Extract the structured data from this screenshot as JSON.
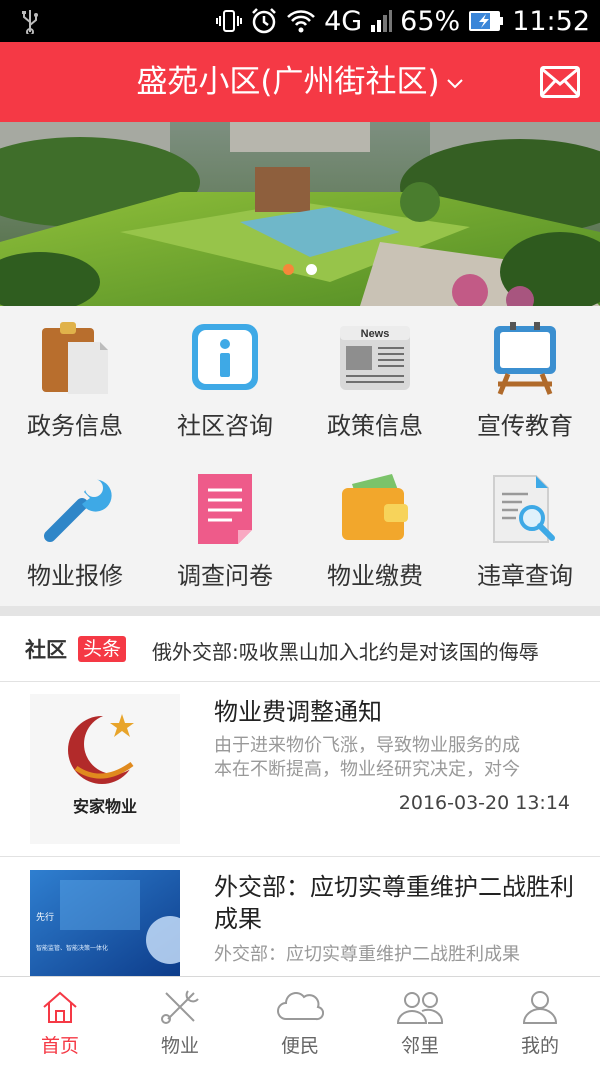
{
  "status_bar": {
    "network": "4G",
    "battery": "65%",
    "time": "11:52"
  },
  "header": {
    "community": "盛苑小区(广州街社区)",
    "icons": [
      "chevron-down-icon",
      "mail-icon"
    ]
  },
  "banner": {
    "page_count": 2,
    "active_index": 0
  },
  "grid": {
    "items": [
      {
        "label": "政务信息",
        "icon": "clipboard-icon"
      },
      {
        "label": "社区咨询",
        "icon": "info-icon"
      },
      {
        "label": "政策信息",
        "icon": "newspaper-icon"
      },
      {
        "label": "宣传教育",
        "icon": "easel-icon"
      },
      {
        "label": "物业报修",
        "icon": "wrench-icon"
      },
      {
        "label": "调查问卷",
        "icon": "document-icon"
      },
      {
        "label": "物业缴费",
        "icon": "wallet-icon"
      },
      {
        "label": "违章查询",
        "icon": "search-document-icon"
      }
    ]
  },
  "headline": {
    "label_a": "社区",
    "label_b": "头条",
    "text": "俄外交部:吸收黑山加入北约是对该国的侮辱"
  },
  "news": [
    {
      "title": "物业费调整通知",
      "summary_line1": "由于进来物价飞涨，导致物业服务的成",
      "summary_line2": "本在不断提高，物业经研究决定，对今",
      "date": "2016-03-20 13:14",
      "thumb_text": "安家物业"
    },
    {
      "title": "外交部：应切实尊重维护二战胜利成果",
      "summary_line1": "外交部：应切实尊重维护二战胜利成果",
      "thumb_text_1": "先行",
      "thumb_text_2": "智能监管、智能决策一体化"
    }
  ],
  "tabbar": {
    "items": [
      {
        "label": "首页",
        "icon": "home-icon",
        "active": true
      },
      {
        "label": "物业",
        "icon": "tools-icon",
        "active": false
      },
      {
        "label": "便民",
        "icon": "cloud-icon",
        "active": false
      },
      {
        "label": "邻里",
        "icon": "people-icon",
        "active": false
      },
      {
        "label": "我的",
        "icon": "person-icon",
        "active": false
      }
    ]
  },
  "colors": {
    "brand_red": "#f53945",
    "dot_active": "#f5883a"
  }
}
